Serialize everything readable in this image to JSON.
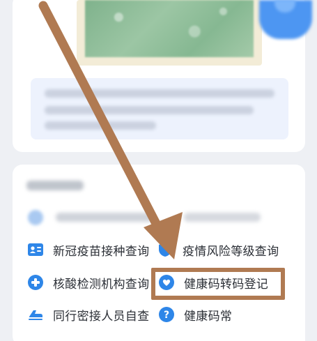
{
  "services": [
    {
      "label": "新冠疫苗接种查询",
      "icon": "id-card-icon"
    },
    {
      "label": "疫情风险等级查询",
      "icon": "shield-icon"
    },
    {
      "label": "核酸检测机构查询",
      "icon": "plus-circle-icon"
    },
    {
      "label": "健康码转码登记",
      "icon": "heart-badge-icon"
    },
    {
      "label": "同行密接人员自查",
      "icon": "train-icon"
    },
    {
      "label": "健康码常",
      "icon": "question-icon"
    }
  ],
  "colors": {
    "accent_blue": "#2e86e8",
    "annotation_brown": "#b07a52",
    "text": "#2b2f36"
  }
}
